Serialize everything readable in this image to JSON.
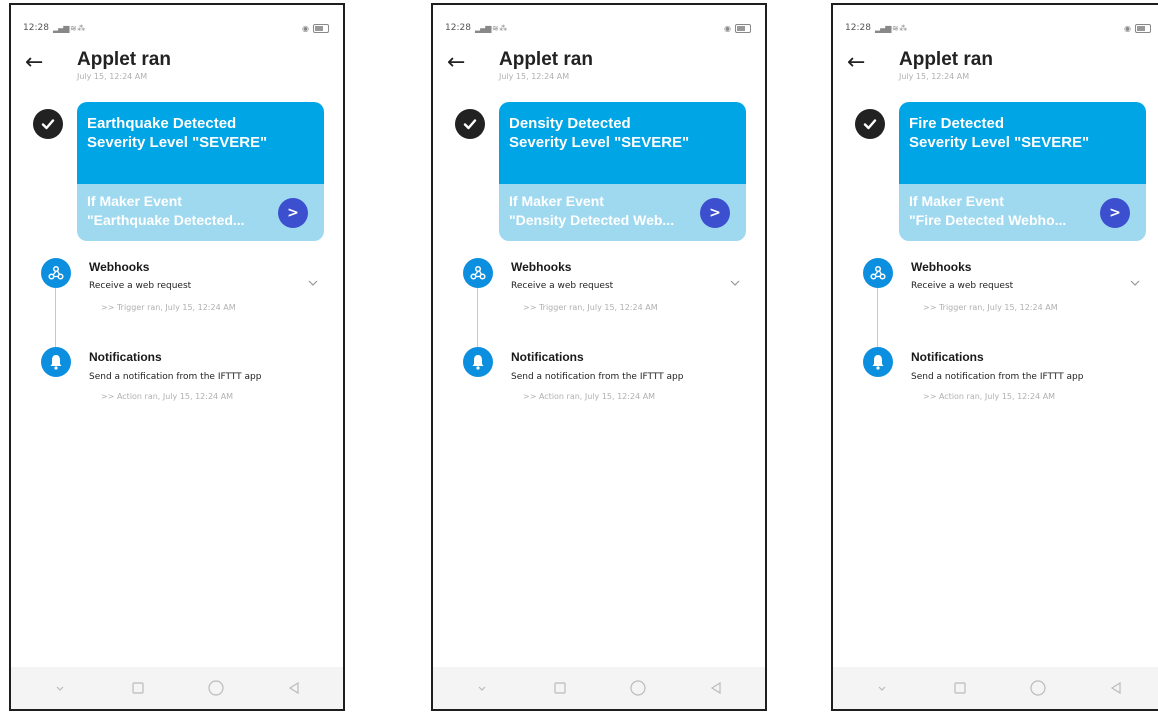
{
  "screens": [
    {
      "status": {
        "time": "12:28"
      },
      "header": {
        "title": "Applet ran",
        "subtitle": "July 15, 12:24 AM"
      },
      "card": {
        "line1": "Earthquake Detected",
        "line2": "Severity Level \"SEVERE\"",
        "event_line1": "If Maker Event",
        "event_line2": "\"Earthquake Detected...",
        "arrow": ">"
      },
      "trigger": {
        "title": "Webhooks",
        "desc": "Receive a web request",
        "ran": ">> Trigger ran, July 15, 12:24 AM"
      },
      "action": {
        "title": "Notifications",
        "desc": "Send a notification from the IFTTT app",
        "ran": ">> Action ran, July 15, 12:24 AM"
      }
    },
    {
      "status": {
        "time": "12:28"
      },
      "header": {
        "title": "Applet ran",
        "subtitle": "July 15, 12:24 AM"
      },
      "card": {
        "line1": "Density Detected",
        "line2": "Severity Level \"SEVERE\"",
        "event_line1": "If Maker Event",
        "event_line2": "\"Density Detected Web...",
        "arrow": ">"
      },
      "trigger": {
        "title": "Webhooks",
        "desc": "Receive a web request",
        "ran": ">> Trigger ran, July 15, 12:24 AM"
      },
      "action": {
        "title": "Notifications",
        "desc": "Send a notification from the IFTTT app",
        "ran": ">> Action ran, July 15, 12:24 AM"
      }
    },
    {
      "status": {
        "time": "12:28"
      },
      "header": {
        "title": "Applet ran",
        "subtitle": "July 15, 12:24 AM"
      },
      "card": {
        "line1": "Fire Detected",
        "line2": "Severity Level \"SEVERE\"",
        "event_line1": "If Maker Event",
        "event_line2": "\"Fire Detected Webho...",
        "arrow": ">"
      },
      "trigger": {
        "title": "Webhooks",
        "desc": "Receive a web request",
        "ran": ">> Trigger ran, July 15, 12:24 AM"
      },
      "action": {
        "title": "Notifications",
        "desc": "Send a notification from the IFTTT app",
        "ran": ">> Action ran, July 15, 12:24 AM"
      }
    }
  ],
  "colors": {
    "card_top": "#00a5e6",
    "card_bottom": "#9fd9ef",
    "arrow_button": "#3b4fcf",
    "step_icon": "#0d8fe0"
  },
  "icons": {
    "back": "arrow-left-icon",
    "check": "check-circle-icon",
    "webhooks": "webhooks-icon",
    "notifications": "bell-icon",
    "expand": "chevron-down-icon",
    "nav": [
      "nav-down-icon",
      "nav-recents-icon",
      "nav-home-icon",
      "nav-back-icon"
    ]
  }
}
